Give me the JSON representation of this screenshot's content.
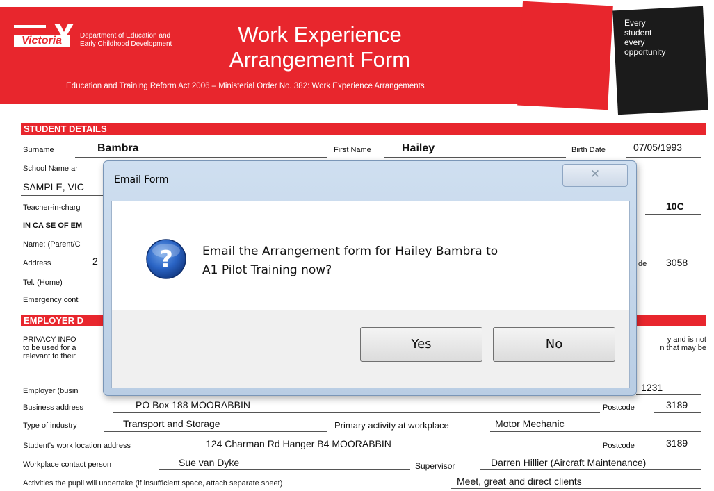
{
  "header": {
    "logo_text": "Victoria",
    "department_line1": "Department of Education and",
    "department_line2": "Early Childhood Development",
    "title_line1": "Work Experience",
    "title_line2": "Arrangement Form",
    "act_line": "Education and Training Reform Act 2006 – Ministerial Order No. 382: Work Experience Arrangements",
    "slogan": [
      "Every",
      "student",
      "every",
      "opportunity"
    ],
    "colors": {
      "brand_red": "#e8262d",
      "slogan_bg": "#1b1b1b"
    }
  },
  "student": {
    "section": "STUDENT DETAILS",
    "surname_label": "Surname",
    "surname": "Bambra",
    "first_name_label": "First Name",
    "first_name": "Hailey",
    "birth_label": "Birth Date",
    "birth_date": "07/05/1993",
    "school_label": "School Name ar",
    "school_value": "SAMPLE, VIC",
    "teacher_label": "Teacher-in-charg",
    "form_value": "10C",
    "emergency_heading": "IN CA SE OF EM",
    "name_label": "Name: (Parent/C",
    "address_label": "Address",
    "address_value": "2",
    "postcode_label_cut": "de",
    "postcode": "3058",
    "tel_label": "Tel. (Home)",
    "emergency_label": "Emergency cont"
  },
  "employer": {
    "section": "EMPLOYER D",
    "privacy_left": [
      "PRIVACY INFO",
      "to be used for a",
      "relevant to their"
    ],
    "privacy_right": [
      "y and is not",
      "n that may be"
    ],
    "employer_label": "Employer (busin",
    "phone_value": "1231",
    "business_address_label": "Business address",
    "business_address": "PO Box 188 MOORABBIN",
    "postcode_label": "Postcode",
    "business_postcode": "3189",
    "industry_label": "Type of industry",
    "industry": "Transport and Storage",
    "primary_label": "Primary activity at workplace",
    "primary_activity": "Motor Mechanic",
    "work_location_label": "Student's work location address",
    "work_location": "124 Charman Rd  Hanger B4 MOORABBIN",
    "work_postcode": "3189",
    "contact_label": "Workplace contact person",
    "contact": "Sue van Dyke",
    "supervisor_label": "Supervisor",
    "supervisor": "Darren Hillier (Aircraft Maintenance)",
    "activities_label": "Activities the pupil will undertake (if insufficient space, attach separate sheet)",
    "activities": "Meet, great and direct clients"
  },
  "dialog": {
    "title": "Email Form",
    "close_icon": "close-x",
    "icon": "question-icon",
    "message_line1": "Email the Arrangement form for Hailey Bambra to",
    "message_line2": "A1 Pilot Training now?",
    "yes_label": "Yes",
    "no_label": "No"
  }
}
